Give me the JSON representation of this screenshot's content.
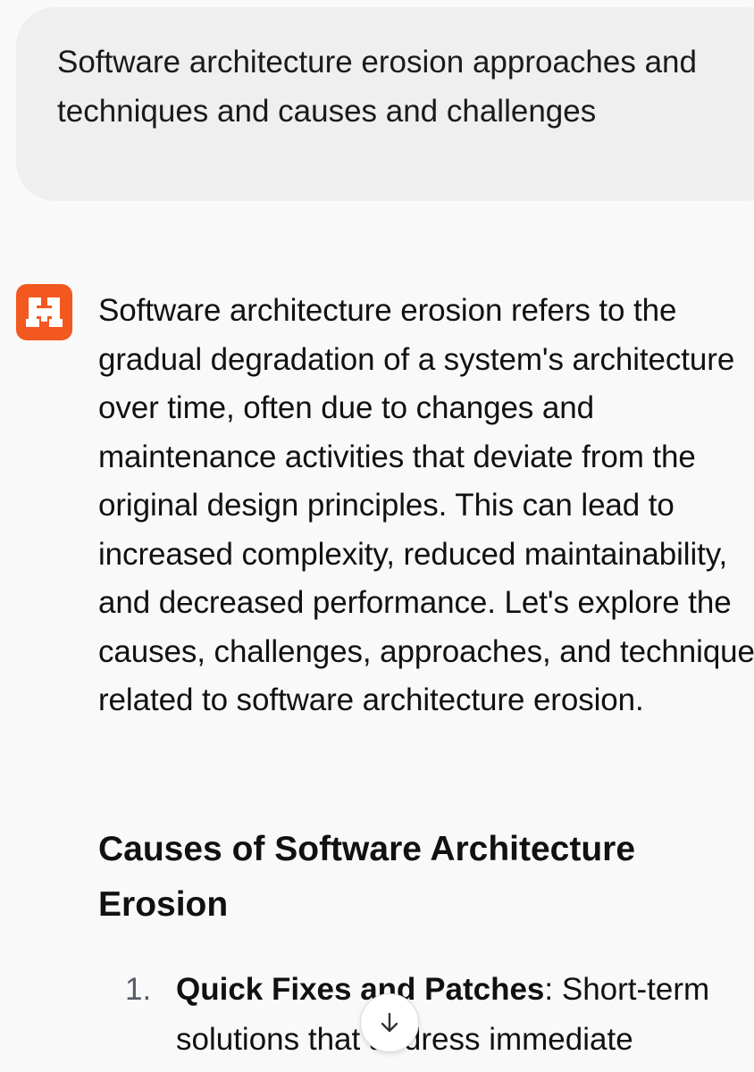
{
  "user_message": {
    "text": "Software architecture erosion approaches and techniques and causes and challenges"
  },
  "assistant": {
    "avatar_icon": "mistral-logo-icon",
    "avatar_color": "#f2581f",
    "intro": "Software architecture erosion refers to the gradual degradation of a system's architecture over time, often due to changes and maintenance activities that deviate from the original design principles. This can lead to increased complexity, reduced maintainability, and decreased performance. Let's explore the causes, challenges, approaches, and techniques related to software architecture erosion.",
    "section_heading": "Causes of Software Architecture Erosion",
    "list": [
      {
        "number": "1.",
        "title": "Quick Fixes and Patches",
        "text": ": Short-term solutions that address immediate"
      }
    ]
  },
  "scroll_button": {
    "icon": "arrow-down-icon"
  }
}
